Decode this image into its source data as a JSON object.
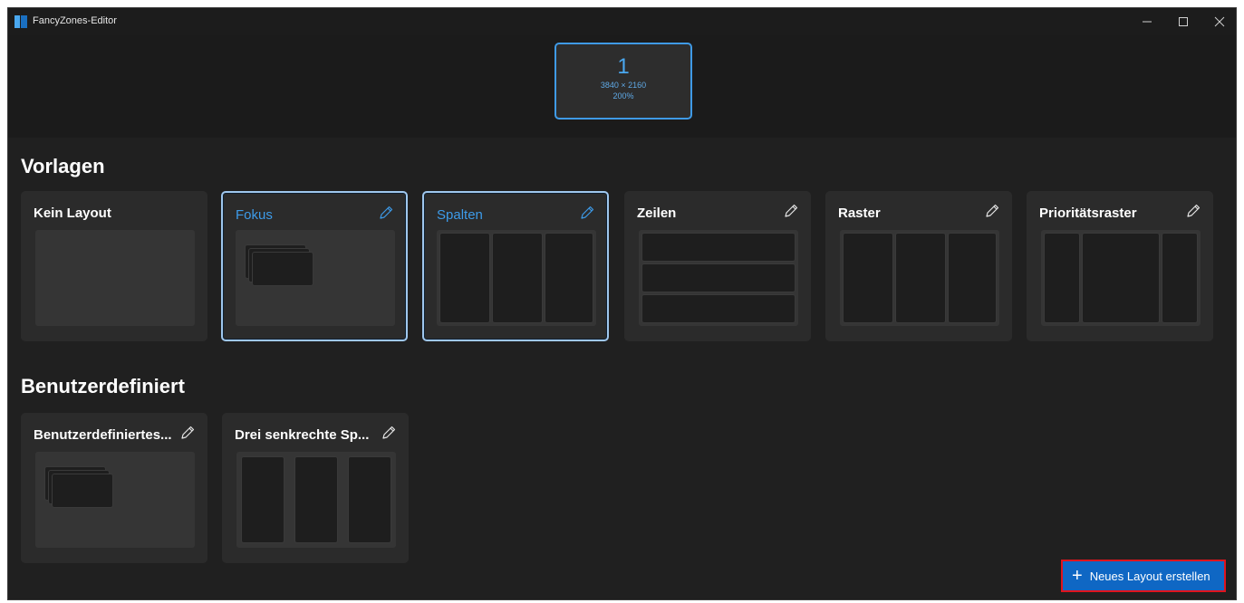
{
  "window": {
    "title": "FancyZones-Editor"
  },
  "monitor": {
    "number": "1",
    "resolution": "3840 × 2160",
    "scale": "200%"
  },
  "sections": {
    "templates": "Vorlagen",
    "custom": "Benutzerdefiniert"
  },
  "templates": [
    {
      "label": "Kein Layout",
      "selected": false,
      "editable": false
    },
    {
      "label": "Fokus",
      "selected": true,
      "editable": true
    },
    {
      "label": "Spalten",
      "selected": true,
      "editable": true
    },
    {
      "label": "Zeilen",
      "selected": false,
      "editable": true
    },
    {
      "label": "Raster",
      "selected": false,
      "editable": true
    },
    {
      "label": "Prioritätsraster",
      "selected": false,
      "editable": true
    }
  ],
  "custom_layouts": [
    {
      "label": "Benutzerdefiniertes...",
      "editable": true
    },
    {
      "label": "Drei senkrechte Sp...",
      "editable": true
    }
  ],
  "new_layout_button": {
    "label": "Neues Layout erstellen",
    "icon": "plus-icon"
  },
  "colors": {
    "accent": "#3d9be9",
    "button": "#0f67c4",
    "highlight": "#e0141e"
  }
}
